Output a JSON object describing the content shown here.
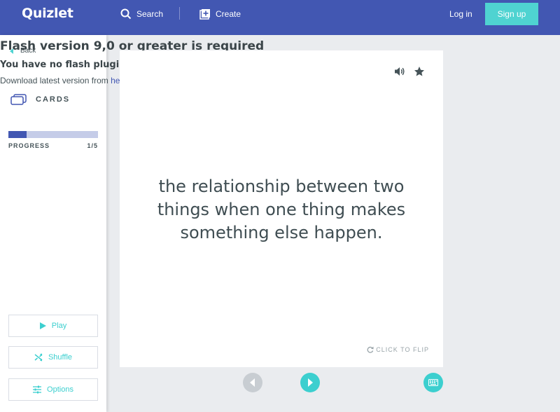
{
  "header": {
    "logo": "Quizlet",
    "search_label": "Search",
    "create_label": "Create",
    "login_label": "Log in",
    "signup_label": "Sign up"
  },
  "flash_notice": {
    "title": "Flash version 9,0 or greater is required",
    "subtitle": "You have no flash plugin installed",
    "download_prefix": "Download latest version from ",
    "download_link": "here"
  },
  "sidebar": {
    "back_label": "Back",
    "mode_label": "CARDS",
    "progress_label": "PROGRESS",
    "progress_count": "1/5",
    "progress_fraction": 0.2,
    "play_label": "Play",
    "shuffle_label": "Shuffle",
    "options_label": "Options"
  },
  "card": {
    "text": "the relationship between two things when one thing makes something else happen.",
    "flip_label": "CLICK TO FLIP"
  },
  "icons": {
    "search": "search-icon",
    "create": "create-icon",
    "back": "back-arrow-icon",
    "cards": "cards-icon",
    "play": "play-icon",
    "shuffle": "shuffle-icon",
    "options": "options-icon",
    "audio": "audio-icon",
    "star": "star-icon",
    "flip": "flip-icon",
    "prev": "prev-arrow-icon",
    "next": "next-arrow-icon",
    "keyboard": "keyboard-icon"
  },
  "colors": {
    "brand": "#4257b2",
    "accent": "#4fd3d1",
    "progress_track": "#c5cce8"
  }
}
